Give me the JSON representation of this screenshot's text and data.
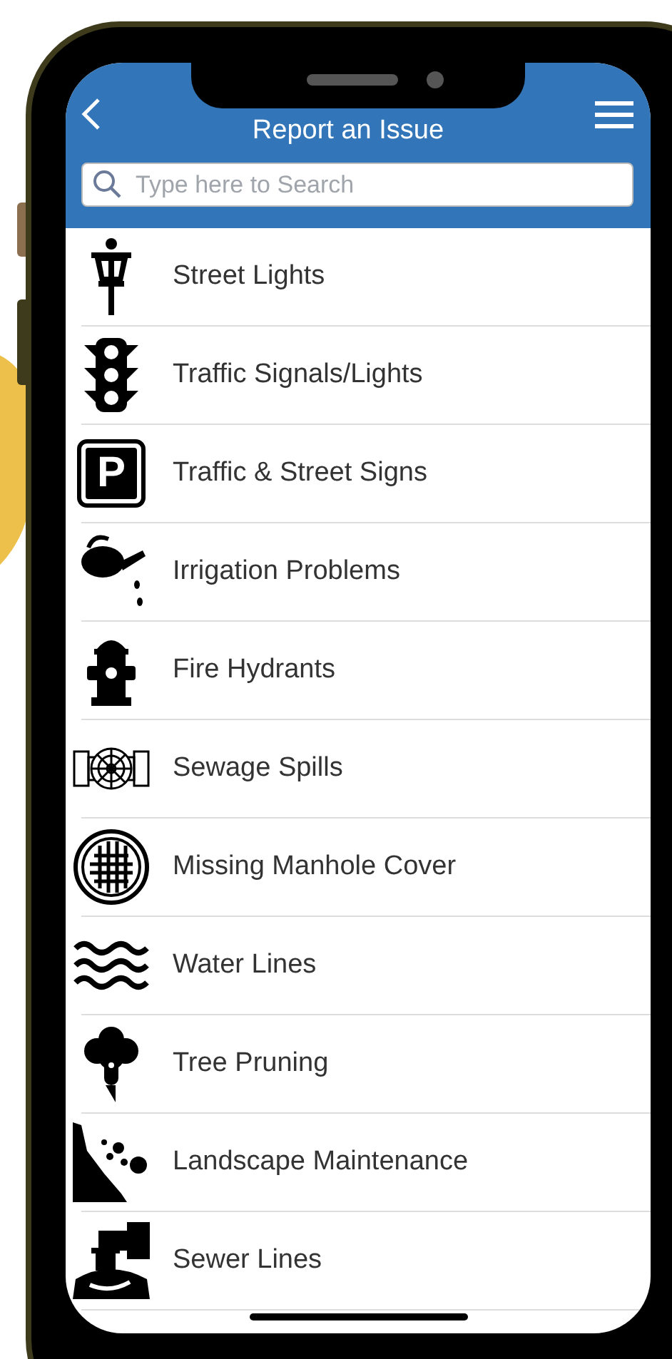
{
  "header": {
    "title": "Report an Issue"
  },
  "search": {
    "placeholder": "Type here to Search"
  },
  "items": [
    {
      "label": "Street Lights"
    },
    {
      "label": "Traffic Signals/Lights"
    },
    {
      "label": "Traffic & Street Signs",
      "icon_letter": "P"
    },
    {
      "label": "Irrigation Problems"
    },
    {
      "label": "Fire Hydrants"
    },
    {
      "label": "Sewage Spills"
    },
    {
      "label": "Missing Manhole Cover"
    },
    {
      "label": "Water Lines"
    },
    {
      "label": "Tree Pruning"
    },
    {
      "label": "Landscape Maintenance"
    },
    {
      "label": "Sewer Lines"
    }
  ]
}
